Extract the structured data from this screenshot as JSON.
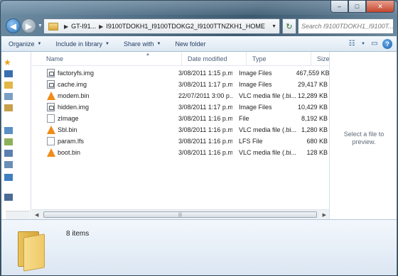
{
  "window": {
    "caption_min": "–",
    "caption_max": "□",
    "caption_close": "✕"
  },
  "navigation": {
    "back_icon": "◀",
    "forward_icon": "▶",
    "address_crumb_1": "GT-I91...",
    "address_crumb_2": "I9100TDOKH1_I9100TDOKG2_I9100TTNZKH1_HOME",
    "search_placeholder": "Search I9100TDOKH1_I9100T...",
    "refresh_icon": "↻"
  },
  "toolbar": {
    "organize": "Organize",
    "include_in_library": "Include in library",
    "share_with": "Share with",
    "new_folder": "New folder"
  },
  "columns": {
    "name": "Name",
    "date_modified": "Date modified",
    "type": "Type",
    "size": "Size"
  },
  "files": [
    {
      "name": "factoryfs.img",
      "date": "3/08/2011 1:15 p.m.",
      "type": "Image Files",
      "size": "467,559 KB",
      "icon": "image-file-icon"
    },
    {
      "name": "cache.img",
      "date": "3/08/2011 1:17 p.m.",
      "type": "Image Files",
      "size": "29,417 KB",
      "icon": "image-file-icon"
    },
    {
      "name": "modem.bin",
      "date": "22/07/2011 3:00 p....",
      "type": "VLC media file (.bi...",
      "size": "12,289 KB",
      "icon": "vlc-icon"
    },
    {
      "name": "hidden.img",
      "date": "3/08/2011 1:17 p.m.",
      "type": "Image Files",
      "size": "10,429 KB",
      "icon": "image-file-icon"
    },
    {
      "name": "zImage",
      "date": "3/08/2011 1:16 p.m.",
      "type": "File",
      "size": "8,192 KB",
      "icon": "generic-file-icon"
    },
    {
      "name": "Sbl.bin",
      "date": "3/08/2011 1:16 p.m.",
      "type": "VLC media file (.bi...",
      "size": "1,280 KB",
      "icon": "vlc-icon"
    },
    {
      "name": "param.lfs",
      "date": "3/08/2011 1:16 p.m.",
      "type": "LFS File",
      "size": "680 KB",
      "icon": "generic-file-icon"
    },
    {
      "name": "boot.bin",
      "date": "3/08/2011 1:16 p.m.",
      "type": "VLC media file (.bi...",
      "size": "128 KB",
      "icon": "vlc-icon"
    }
  ],
  "preview": {
    "message": "Select a file to preview."
  },
  "details": {
    "item_count": "8 items"
  }
}
